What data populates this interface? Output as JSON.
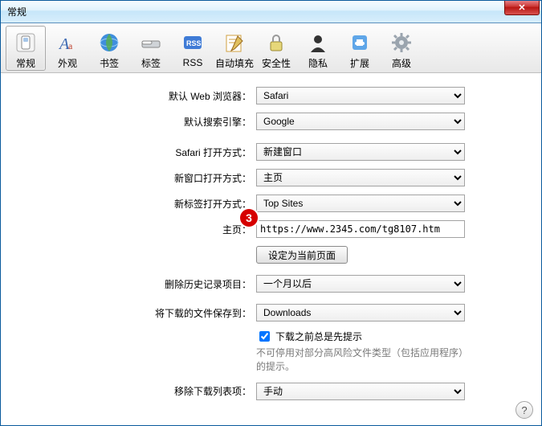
{
  "window": {
    "title": "常规",
    "close": "✕"
  },
  "toolbar": {
    "items": [
      {
        "label": "常规"
      },
      {
        "label": "外观"
      },
      {
        "label": "书签"
      },
      {
        "label": "标签"
      },
      {
        "label": "RSS"
      },
      {
        "label": "自动填充"
      },
      {
        "label": "安全性"
      },
      {
        "label": "隐私"
      },
      {
        "label": "扩展"
      },
      {
        "label": "高级"
      }
    ]
  },
  "form": {
    "default_browser": {
      "label": "默认 Web 浏览器：",
      "value": "Safari"
    },
    "default_search": {
      "label": "默认搜索引擎：",
      "value": "Google"
    },
    "safari_open": {
      "label": "Safari 打开方式：",
      "value": "新建窗口"
    },
    "new_window": {
      "label": "新窗口打开方式：",
      "value": "主页"
    },
    "new_tab": {
      "label": "新标签打开方式：",
      "value": "Top Sites"
    },
    "homepage": {
      "label": "主页：",
      "value": "https://www.2345.com/tg8107.htm",
      "callout": "3"
    },
    "set_current": {
      "label": "设定为当前页面"
    },
    "history": {
      "label": "删除历史记录项目：",
      "value": "一个月以后"
    },
    "downloads_loc": {
      "label": "将下载的文件保存到：",
      "value": "Downloads"
    },
    "dl_prompt": {
      "checked": true,
      "label": "下载之前总是先提示"
    },
    "dl_note": "不可停用对部分高风险文件类型（包括应用程序）的提示。",
    "remove_dl": {
      "label": "移除下载列表项：",
      "value": "手动"
    }
  },
  "help": "?"
}
